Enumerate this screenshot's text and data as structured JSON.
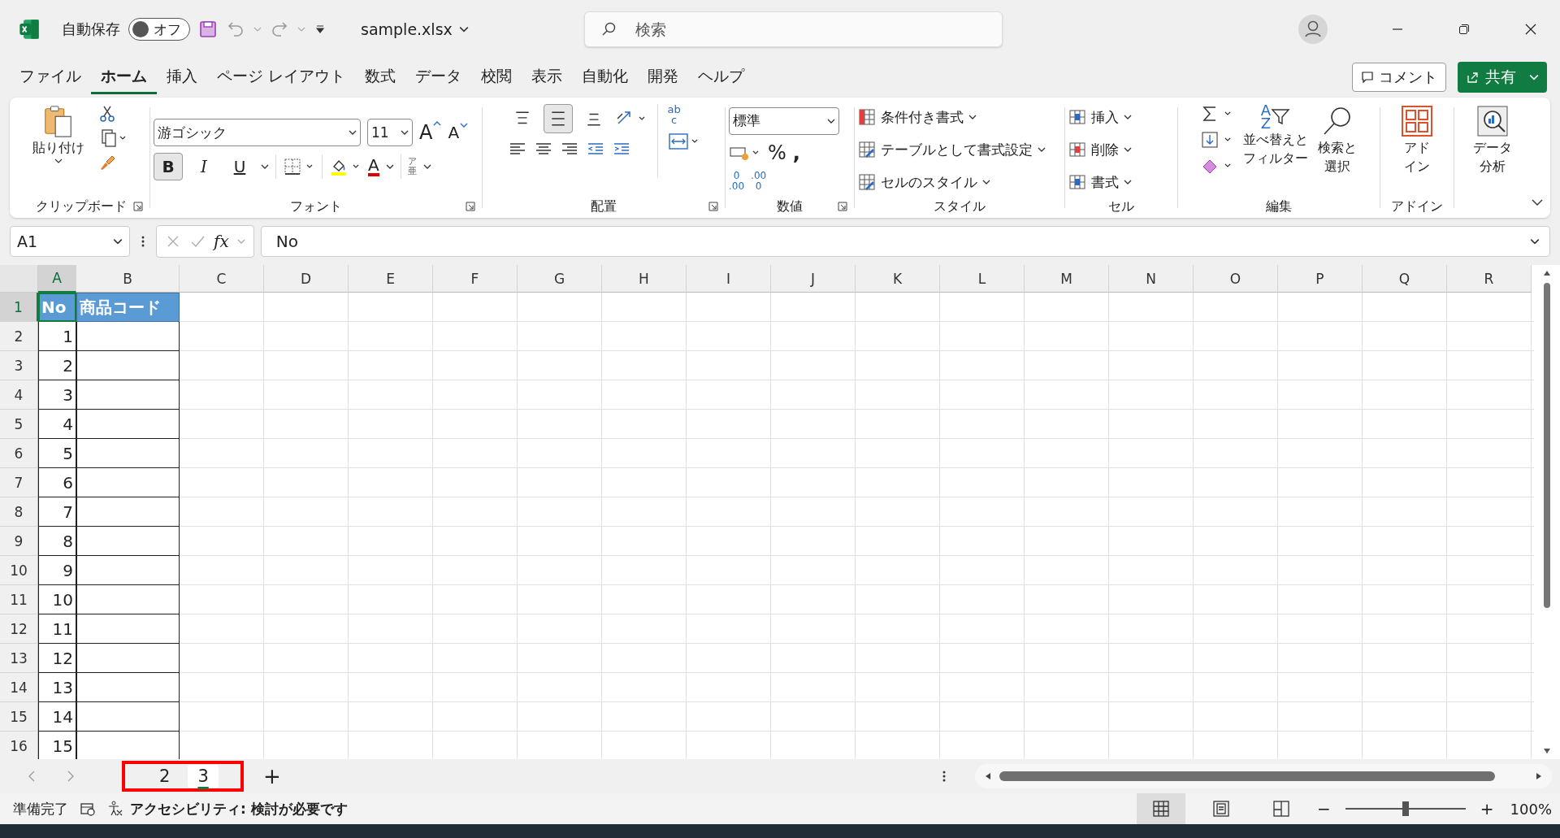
{
  "title_bar": {
    "autosave": {
      "label": "自動保存",
      "state": "オフ",
      "on": false
    },
    "filename": "sample.xlsx",
    "search": {
      "placeholder": "検索"
    }
  },
  "menu_tabs": [
    {
      "label": "ファイル",
      "selected": false
    },
    {
      "label": "ホーム",
      "selected": true
    },
    {
      "label": "挿入",
      "selected": false
    },
    {
      "label": "ページ レイアウト",
      "selected": false
    },
    {
      "label": "数式",
      "selected": false
    },
    {
      "label": "データ",
      "selected": false
    },
    {
      "label": "校閲",
      "selected": false
    },
    {
      "label": "表示",
      "selected": false
    },
    {
      "label": "自動化",
      "selected": false
    },
    {
      "label": "開発",
      "selected": false
    },
    {
      "label": "ヘルプ",
      "selected": false
    }
  ],
  "comment_button": "コメント",
  "share_button": "共有",
  "ribbon": {
    "clipboard": {
      "paste": "貼り付け",
      "label": "クリップボード"
    },
    "font": {
      "name": "游ゴシック",
      "size": "11",
      "grow": "A",
      "shrink": "A",
      "styles": [
        {
          "kind": "bold",
          "glyph": "B",
          "selected": true
        },
        {
          "kind": "italic",
          "glyph": "I",
          "selected": false
        },
        {
          "kind": "underline",
          "glyph": "U",
          "selected": false
        }
      ],
      "font_color": "A",
      "phonetic": [
        "ア",
        "亜"
      ],
      "label": "フォント"
    },
    "alignment": {
      "vertical": [
        {
          "kind": "top",
          "selected": false
        },
        {
          "kind": "middle",
          "selected": true
        },
        {
          "kind": "bottom",
          "selected": false
        }
      ],
      "wrap": [
        "ab",
        "c"
      ],
      "label": "配置"
    },
    "number": {
      "format": "標準",
      "percent": "%",
      "comma": ",",
      "increase_decimal": [
        "0",
        ".00"
      ],
      "decrease_decimal": [
        ".00",
        "0"
      ],
      "label": "数値"
    },
    "styles": {
      "items": [
        "条件付き書式",
        "テーブルとして書式設定",
        "セルのスタイル"
      ],
      "label": "スタイル"
    },
    "cells": {
      "items": [
        "挿入",
        "削除",
        "書式"
      ],
      "label": "セル"
    },
    "editing": {
      "sort_glyph": [
        "A",
        "Z"
      ],
      "sort_filter": [
        "並べ替えと",
        "フィルター"
      ],
      "find_select": [
        "検索と",
        "選択"
      ],
      "label": "編集"
    },
    "addins": {
      "button": [
        "アド",
        "イン"
      ],
      "label": "アドイン"
    },
    "analysis": {
      "button": [
        "データ",
        "分析"
      ]
    }
  },
  "formula_bar": {
    "name_box": "A1",
    "fx": "fx",
    "content": "No"
  },
  "sheet": {
    "columns": [
      {
        "label": "A",
        "selected": true
      },
      {
        "label": "B",
        "selected": false
      },
      {
        "label": "C",
        "selected": false
      },
      {
        "label": "D",
        "selected": false
      },
      {
        "label": "E",
        "selected": false
      },
      {
        "label": "F",
        "selected": false
      },
      {
        "label": "G",
        "selected": false
      },
      {
        "label": "H",
        "selected": false
      },
      {
        "label": "I",
        "selected": false
      },
      {
        "label": "J",
        "selected": false
      },
      {
        "label": "K",
        "selected": false
      },
      {
        "label": "L",
        "selected": false
      },
      {
        "label": "M",
        "selected": false
      },
      {
        "label": "N",
        "selected": false
      },
      {
        "label": "O",
        "selected": false
      },
      {
        "label": "P",
        "selected": false
      },
      {
        "label": "Q",
        "selected": false
      },
      {
        "label": "R",
        "selected": false
      }
    ],
    "rows": [
      {
        "number": "1",
        "selected": true,
        "kind": "header",
        "no": "No",
        "code": "商品コード"
      },
      {
        "number": "2",
        "selected": false,
        "kind": "data",
        "no": "1"
      },
      {
        "number": "3",
        "selected": false,
        "kind": "data",
        "no": "2"
      },
      {
        "number": "4",
        "selected": false,
        "kind": "data",
        "no": "3"
      },
      {
        "number": "5",
        "selected": false,
        "kind": "data",
        "no": "4"
      },
      {
        "number": "6",
        "selected": false,
        "kind": "data",
        "no": "5"
      },
      {
        "number": "7",
        "selected": false,
        "kind": "data",
        "no": "6"
      },
      {
        "number": "8",
        "selected": false,
        "kind": "data",
        "no": "7"
      },
      {
        "number": "9",
        "selected": false,
        "kind": "data",
        "no": "8"
      },
      {
        "number": "10",
        "selected": false,
        "kind": "data",
        "no": "9"
      },
      {
        "number": "11",
        "selected": false,
        "kind": "data",
        "no": "10"
      },
      {
        "number": "12",
        "selected": false,
        "kind": "data",
        "no": "11"
      },
      {
        "number": "13",
        "selected": false,
        "kind": "data",
        "no": "12"
      },
      {
        "number": "14",
        "selected": false,
        "kind": "data",
        "no": "13"
      },
      {
        "number": "15",
        "selected": false,
        "kind": "data",
        "no": "14"
      },
      {
        "number": "16",
        "selected": false,
        "kind": "data",
        "no": "15"
      }
    ]
  },
  "sheet_tabs": {
    "tabs": [
      {
        "label": "2",
        "selected": false
      },
      {
        "label": "3",
        "selected": true
      }
    ],
    "highlight": true,
    "add": "+"
  },
  "status_bar": {
    "ready": "準備完了",
    "accessibility": "アクセシビリティ: 検討が必要です",
    "views": [
      {
        "kind": "normal",
        "selected": true
      },
      {
        "kind": "page_layout",
        "selected": false
      },
      {
        "kind": "page_break",
        "selected": false
      }
    ],
    "zoom": {
      "minus": "−",
      "plus": "+",
      "level": 0.5,
      "reading": "100%"
    }
  }
}
